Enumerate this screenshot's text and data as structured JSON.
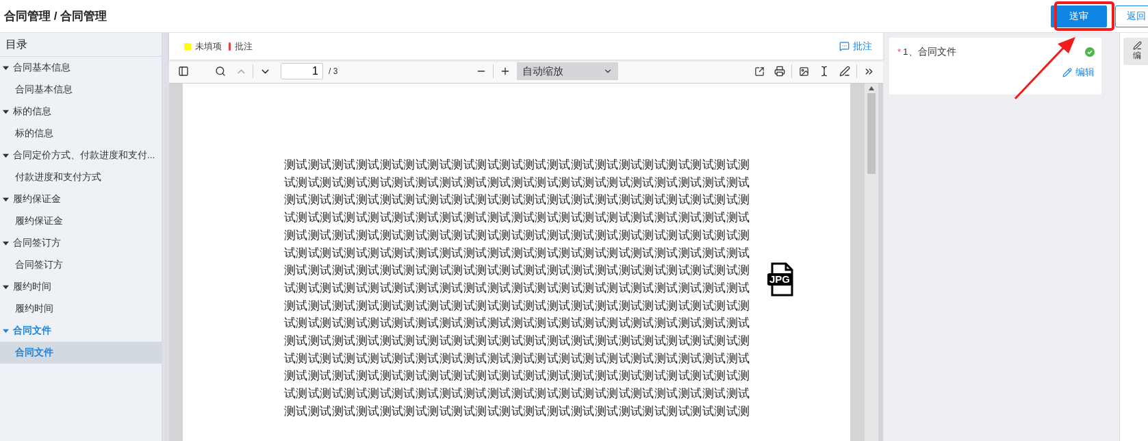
{
  "header": {
    "breadcrumb": "合同管理 / 合同管理",
    "buttons": [
      {
        "label": "送审",
        "kind": "primary"
      },
      {
        "label": "返回",
        "kind": "outline"
      }
    ]
  },
  "sidebar": {
    "title": "目录",
    "groups": [
      {
        "label": "合同基本信息",
        "expanded": true,
        "selected": false,
        "children": [
          {
            "label": "合同基本信息",
            "selected": false
          }
        ]
      },
      {
        "label": "标的信息",
        "expanded": true,
        "selected": false,
        "children": [
          {
            "label": "标的信息",
            "selected": false
          }
        ]
      },
      {
        "label": "合同定价方式、付款进度和支付...",
        "expanded": true,
        "selected": false,
        "children": [
          {
            "label": "付款进度和支付方式",
            "selected": false
          }
        ]
      },
      {
        "label": "履约保证金",
        "expanded": true,
        "selected": false,
        "children": [
          {
            "label": "履约保证金",
            "selected": false
          }
        ]
      },
      {
        "label": "合同签订方",
        "expanded": true,
        "selected": false,
        "children": [
          {
            "label": "合同签订方",
            "selected": false
          }
        ]
      },
      {
        "label": "履约时间",
        "expanded": true,
        "selected": false,
        "children": [
          {
            "label": "履约时间",
            "selected": false
          }
        ]
      },
      {
        "label": "合同文件",
        "expanded": true,
        "selected": true,
        "children": [
          {
            "label": "合同文件",
            "selected": true
          }
        ]
      }
    ]
  },
  "viewer": {
    "legend": [
      {
        "label": "未填项",
        "kind": "square",
        "color": "#ffff00"
      },
      {
        "label": "批注",
        "kind": "bar",
        "color": "#e04444"
      }
    ],
    "annotate_link": "批注",
    "toolbar": {
      "page": "1",
      "page_count": "/ 3",
      "zoom": "自动缩放"
    },
    "document": {
      "lines": [
        "测试测试测试测试测试测试测试测试测试测试测试测试测试测试测试测试测试测试测试测",
        "试测试测试测试测试测试测试测试测试测试测试测试测试测试测试测试测试测试测试测试",
        "测试测试测试测试测试测试测试测试测试测试测试测试测试测试测试测试测试测试测试测",
        "试测试测试测试测试测试测试测试测试测试测试测试测试测试测试测试测试测试测试测试",
        "测试测试测试测试测试测试测试测试测试测试测试测试测试测试测试测试测试测试测试测",
        "试测试测试测试测试测试测试测试测试测试测试测试测试测试测试测试测试测试测试测试",
        "测试测试测试测试测试测试测试测试测试测试测试测试测试测试测试测试测试测试测试测",
        "试测试测试测试测试测试测试测试测试测试测试测试测试测试测试测试测试测试测试测试",
        "测试测试测试测试测试测试测试测试测试测试测试测试测试测试测试测试测试测试测试测",
        "试测试测试测试测试测试测试测试测试测试测试测试测试测试测试测试测试测试测试测试",
        "测试测试测试测试测试测试测试测试测试测试测试测试测试测试测试测试测试测试测试测",
        "试测试测试测试测试测试测试测试测试测试测试测试测试测试测试测试测试测试测试测试",
        "测试测试测试测试测试测试测试测试测试测试测试测试测试测试测试测试测试测试测试测",
        "试测试测试测试测试测试测试测试测试测试测试测试测试测试测试测试测试测试测试测试",
        "测试测试测试测试测试测试测试测试测试测试测试测试测试测试测试测试测试测试测试测"
      ],
      "attachment_label": "JPG"
    }
  },
  "fields": [
    {
      "label": "1、合同文件",
      "required_mark": "*",
      "complete": true,
      "action": "编辑"
    }
  ],
  "side_tools": [
    {
      "label": "编"
    }
  ]
}
